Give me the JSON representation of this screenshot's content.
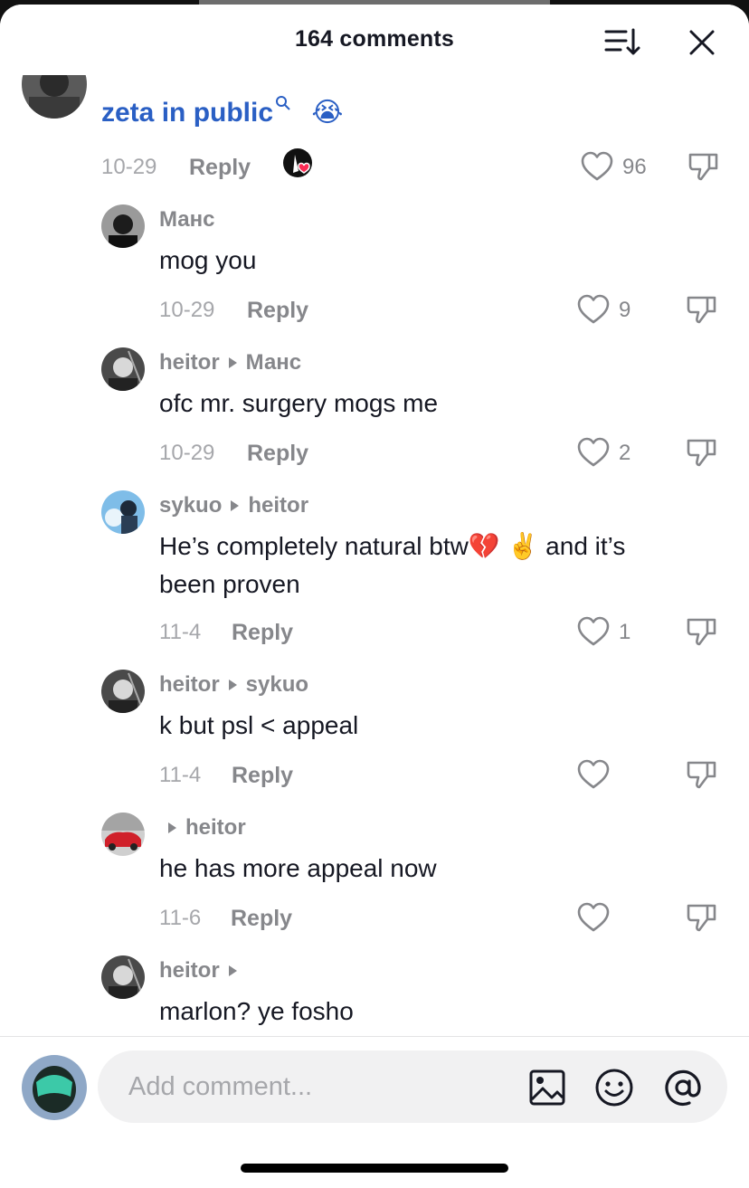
{
  "header": {
    "title": "164 comments"
  },
  "top_comment": {
    "mention_text": "zeta in public",
    "emoji": "😭",
    "date": "10-29",
    "reply_label": "Reply",
    "likes": "96"
  },
  "replies": [
    {
      "user": "Манс",
      "reply_to": "",
      "text": "mog you",
      "date": "10-29",
      "reply_label": "Reply",
      "likes": "9"
    },
    {
      "user": "heitor",
      "reply_to": "Манс",
      "text": "ofc mr. surgery mogs me",
      "date": "10-29",
      "reply_label": "Reply",
      "likes": "2"
    },
    {
      "user": "sykuo",
      "reply_to": "heitor",
      "text_a": "He’s completely natural btw",
      "emoji_a": "💔",
      "emoji_b": "✌️",
      "text_b": " and it’s",
      "text_c": "been proven",
      "date": "11-4",
      "reply_label": "Reply",
      "likes": "1"
    },
    {
      "user": "heitor",
      "reply_to": "sykuo",
      "text": "k but psl < appeal",
      "date": "11-4",
      "reply_label": "Reply",
      "likes": ""
    },
    {
      "user": "",
      "reply_to": "heitor",
      "text": "he has more appeal now",
      "date": "11-6",
      "reply_label": "Reply",
      "likes": ""
    },
    {
      "user": "heitor",
      "reply_to": "",
      "text": "marlon? ye fosho",
      "date": "",
      "reply_label": "",
      "likes": ""
    }
  ],
  "composer": {
    "placeholder": "Add comment..."
  },
  "icons": {
    "sort": "sort-icon",
    "close": "close-icon",
    "heart": "heart-outline-icon",
    "dislike": "thumbs-down-icon",
    "image": "image-icon",
    "emoji": "emoji-icon",
    "mention": "at-sign-icon"
  },
  "colors": {
    "mention": "#2a5fc4",
    "secondary_text": "#86878b",
    "like_heart": "#fe2c55"
  }
}
